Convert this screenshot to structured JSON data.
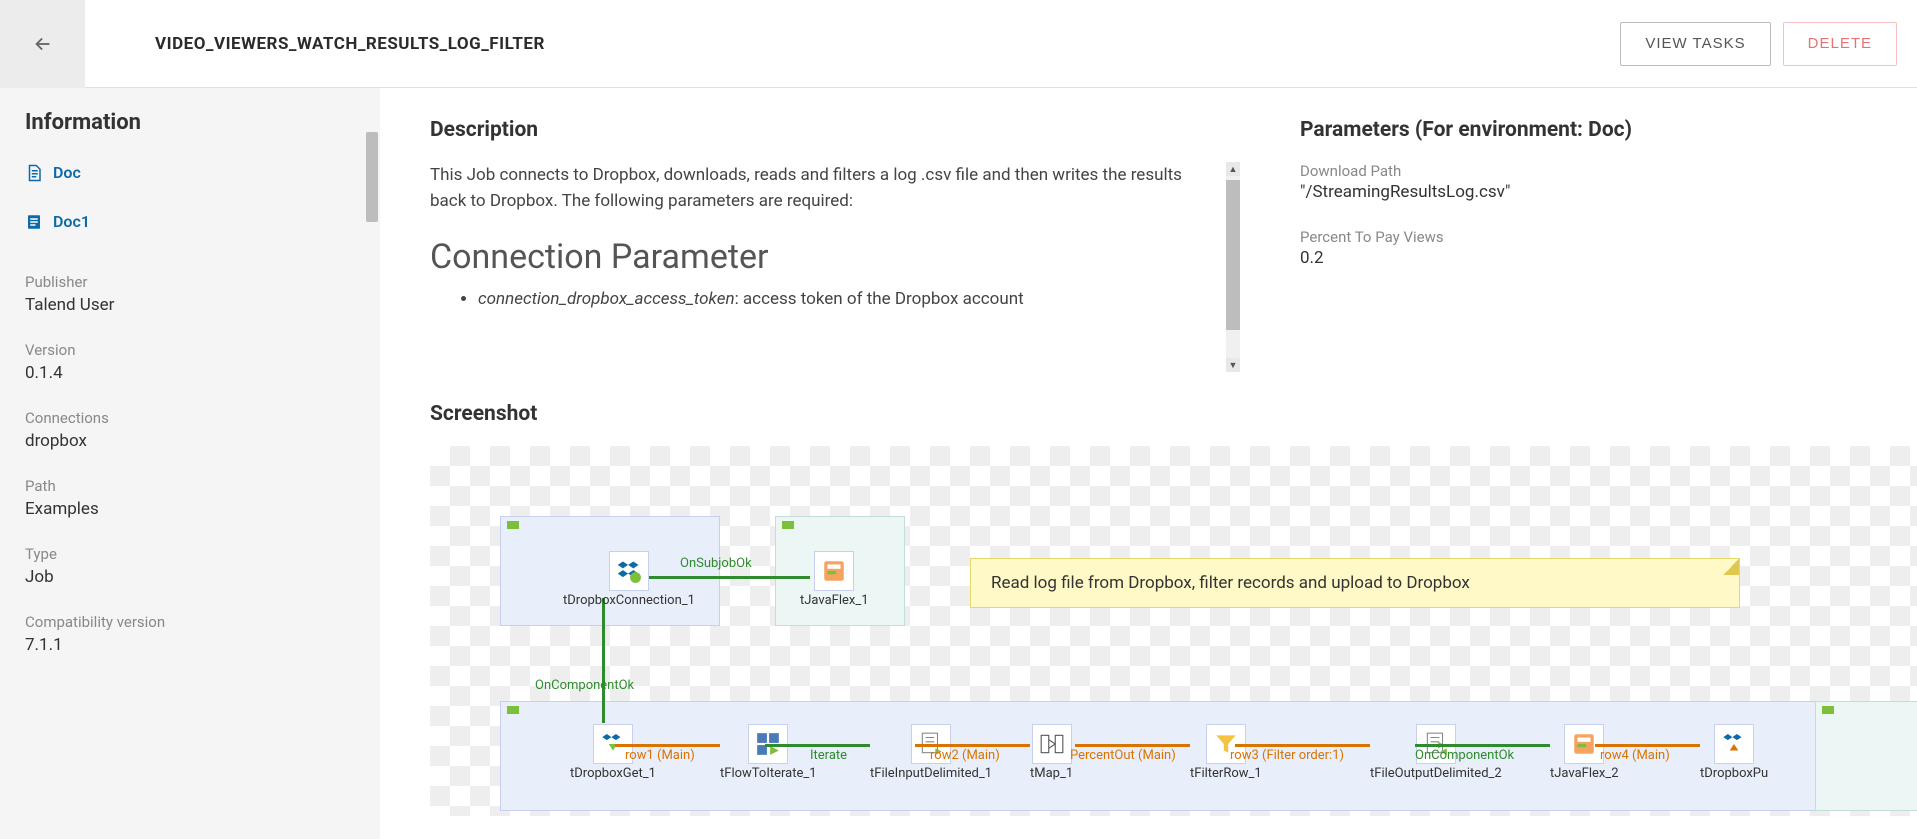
{
  "header": {
    "title": "VIDEO_VIEWERS_WATCH_RESULTS_LOG_FILTER",
    "view_tasks": "VIEW TASKS",
    "delete": "DELETE"
  },
  "sidebar": {
    "heading": "Information",
    "docs": [
      {
        "label": "Doc"
      },
      {
        "label": "Doc1"
      }
    ],
    "meta": [
      {
        "label": "Publisher",
        "value": "Talend User"
      },
      {
        "label": "Version",
        "value": "0.1.4"
      },
      {
        "label": "Connections",
        "value": "dropbox"
      },
      {
        "label": "Path",
        "value": "Examples"
      },
      {
        "label": "Type",
        "value": "Job"
      },
      {
        "label": "Compatibility version",
        "value": "7.1.1"
      }
    ]
  },
  "description": {
    "heading": "Description",
    "body": "This Job connects to Dropbox, downloads, reads and filters a log .csv file and then writes the results back to Dropbox. The following parameters are required:",
    "subheading": "Connection Parameter",
    "bullet_name": "connection_dropbox_access_token",
    "bullet_rest": ": access token of the Dropbox account"
  },
  "parameters": {
    "heading": "Parameters (For environment: Doc)",
    "items": [
      {
        "label": "Download Path",
        "value": "\"/StreamingResultsLog.csv\""
      },
      {
        "label": "Percent To Pay Views",
        "value": "0.2"
      }
    ]
  },
  "screenshot": {
    "heading": "Screenshot",
    "note": "Read log file from Dropbox, filter records and upload to Dropbox",
    "components": {
      "c1": "tDropboxConnection_1",
      "c2": "tJavaFlex_1",
      "c3": "tDropboxGet_1",
      "c4": "tFlowToIterate_1",
      "c5": "tFileInputDelimited_1",
      "c6": "tMap_1",
      "c7": "tFilterRow_1",
      "c8": "tFileOutputDelimited_2",
      "c9": "tJavaFlex_2",
      "c10": "tDropboxPu"
    },
    "links": {
      "l1": "OnSubjobOk",
      "l2": "OnComponentOk",
      "l3": "row1 (Main)",
      "l4": "Iterate",
      "l5": "row2 (Main)",
      "l6": "PercentOut (Main)",
      "l7": "row3 (Filter order:1)",
      "l8": "OnComponentOk",
      "l9": "row4 (Main)"
    }
  }
}
